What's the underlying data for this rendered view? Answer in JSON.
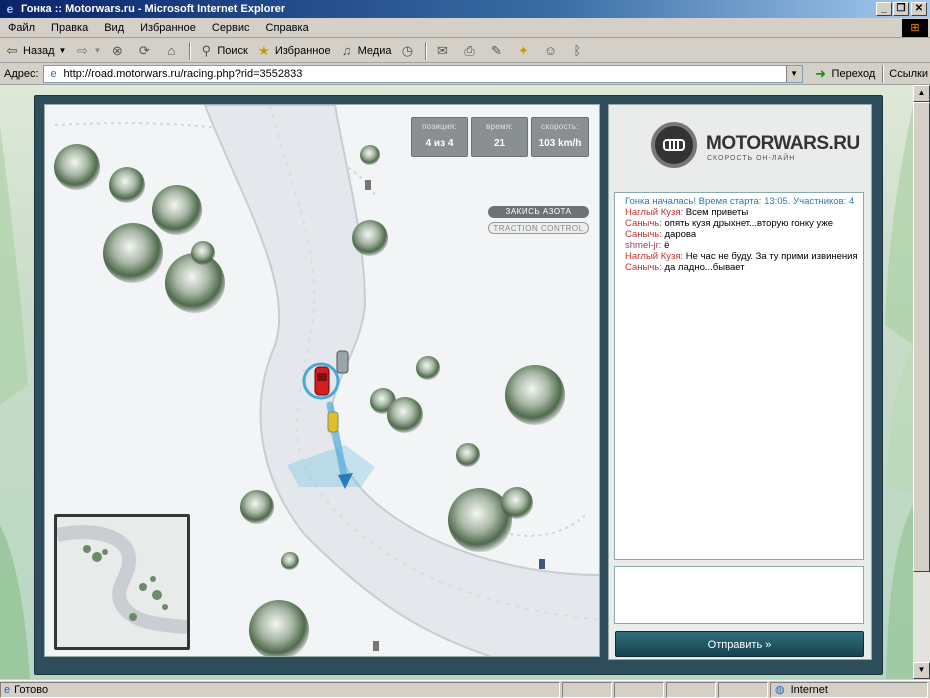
{
  "window": {
    "title": "Гонка :: Motorwars.ru - Microsoft Internet Explorer",
    "min": "_",
    "max": "❐",
    "close": "✕"
  },
  "menu": [
    "Файл",
    "Правка",
    "Вид",
    "Избранное",
    "Сервис",
    "Справка"
  ],
  "toolbar": {
    "back": "Назад",
    "search": "Поиск",
    "favorites": "Избранное",
    "media": "Медиа"
  },
  "address": {
    "label": "Адрес:",
    "url": "http://road.motorwars.ru/racing.php?rid=3552833",
    "go": "Переход",
    "links": "Ссылки"
  },
  "hud": {
    "position_label": "позиция:",
    "position_value": "4 из 4",
    "time_label": "время:",
    "time_value": "21",
    "speed_label": "скорость:",
    "speed_value": "103 km/h",
    "nitro": "ЗАКИСЬ АЗОТА",
    "traction": "TRACTION CONTROL"
  },
  "logo": {
    "text": "MOTORWARS.RU",
    "subtitle": "СКОРОСТЬ ОН-ЛАЙН"
  },
  "chat": {
    "system": "Гонка началась! Время старта: 13:05. Участников: 4",
    "messages": [
      {
        "nick": "Наглый Кузя:",
        "text": "Всем приветы"
      },
      {
        "nick": "Санычь:",
        "text": "опять кузя дрыхнет...вторую гонку уже"
      },
      {
        "nick": "Санычь:",
        "text": "дарова"
      },
      {
        "nick": "shmel-jr:",
        "text": "ё"
      },
      {
        "nick": "Наглый Кузя:",
        "text": "Не час не буду. За ту прими извинения"
      },
      {
        "nick": "Санычь:",
        "text": "да ладно...бывает"
      }
    ],
    "send": "Отправить »"
  },
  "status": {
    "text": "Готово",
    "zone": "Internet"
  },
  "colors": {
    "frame": "#2e4e5c",
    "system_msg": "#2a7ab8",
    "nick": "#b33"
  }
}
